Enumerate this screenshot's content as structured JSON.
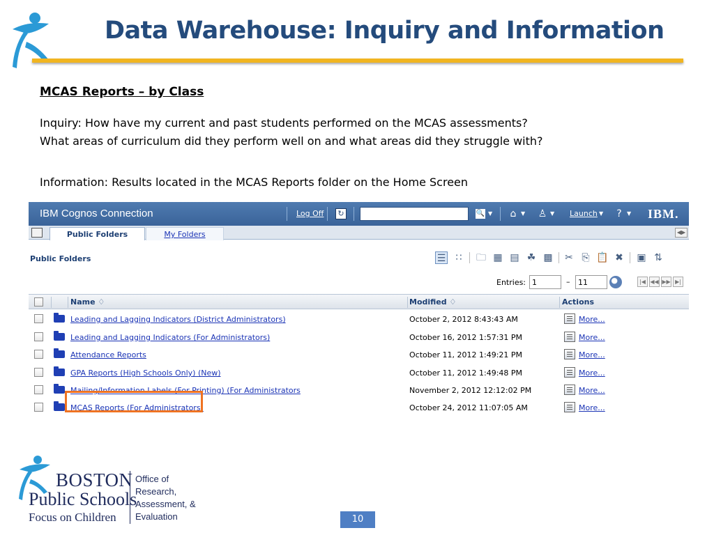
{
  "slide": {
    "title": "Data Warehouse: Inquiry and Information",
    "section_heading": "MCAS Reports – by Class",
    "inquiry_line1": "Inquiry:  How have my current and past students performed on the MCAS assessments?",
    "inquiry_line2": "What areas of curriculum did they perform well on and what areas did they struggle with?",
    "information_line": "Information:  Results located in the MCAS Reports folder on the Home Screen",
    "page_number": "10",
    "accent_color": "#f1b520",
    "title_color": "#244b7c"
  },
  "cognos": {
    "app_title": "IBM Cognos Connection",
    "log_off": "Log Off",
    "search_value": "",
    "launch": "Launch",
    "ibm": "IBM.",
    "tabs": {
      "public": "Public Folders",
      "my": "My Folders"
    },
    "panel_title": "Public Folders",
    "entries_label": "Entries:",
    "entries_from": "1",
    "entries_to": "11",
    "dash": "–",
    "columns": {
      "name": "Name ♢",
      "modified": "Modified ♢",
      "actions": "Actions"
    },
    "rows": [
      {
        "name": "Leading and Lagging Indicators (District Administrators)",
        "modified": "October 2, 2012 8:43:43 AM",
        "action": "More..."
      },
      {
        "name": "Leading and Lagging Indicators (For Administrators)",
        "modified": "October 16, 2012 1:57:31 PM",
        "action": "More..."
      },
      {
        "name": "Attendance Reports",
        "modified": "October 11, 2012 1:49:21 PM",
        "action": "More..."
      },
      {
        "name": "GPA Reports (High Schools Only) (New)",
        "modified": "October 11, 2012 1:49:48 PM",
        "action": "More..."
      },
      {
        "name": "Mailing/Information Labels (For Printing) (For Administrators",
        "modified": "November 2, 2012 12:12:02 PM",
        "action": "More..."
      },
      {
        "name": "MCAS Reports (For Administrators)",
        "modified": "October 24, 2012 11:07:05 AM",
        "action": "More..."
      }
    ],
    "highlight_color": "#ef7322"
  },
  "footer": {
    "brand_boston": "BOSTON",
    "brand_public": "Public Schools",
    "brand_focus": "Focus on Children",
    "office_lines": [
      "Office of",
      "Research,",
      "Assessment, &",
      "Evaluation"
    ]
  }
}
